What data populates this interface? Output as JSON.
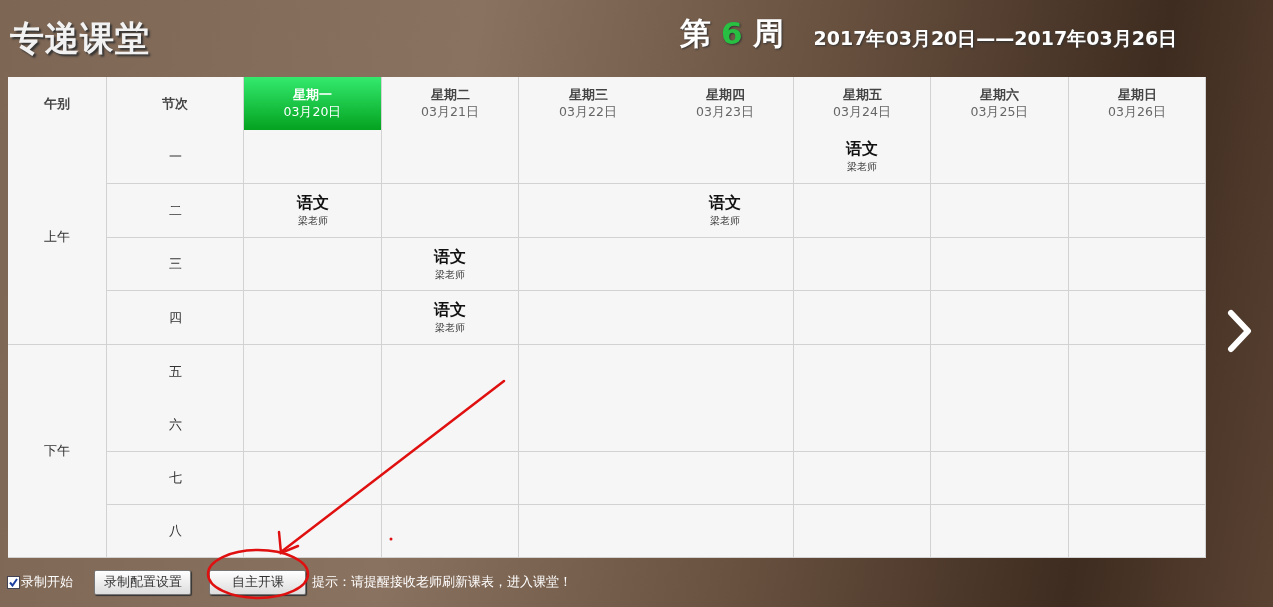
{
  "logo": "专递课堂",
  "week": {
    "prefix": "第",
    "number": "6",
    "suffix": "周"
  },
  "date_range": "2017年03月20日——2017年03月26日",
  "table": {
    "session_heading": "午别",
    "period_heading": "节次",
    "days": [
      {
        "name": "星期一",
        "date": "03月20日",
        "selected": true,
        "line_right": true
      },
      {
        "name": "星期二",
        "date": "03月21日",
        "selected": false,
        "line_right": true
      },
      {
        "name": "星期三",
        "date": "03月22日",
        "selected": false,
        "line_right": false
      },
      {
        "name": "星期四",
        "date": "03月23日",
        "selected": false,
        "line_right": true
      },
      {
        "name": "星期五",
        "date": "03月24日",
        "selected": false,
        "line_right": true
      },
      {
        "name": "星期六",
        "date": "03月25日",
        "selected": false,
        "line_right": true
      },
      {
        "name": "星期日",
        "date": "03月26日",
        "selected": false,
        "line_right": true
      }
    ],
    "sessions": [
      {
        "label": "上午",
        "periods": [
          {
            "label": "一",
            "line_below": true,
            "cells": [
              {},
              {},
              {},
              {},
              {
                "course": "语文",
                "teacher": "梁老师"
              },
              {},
              {}
            ]
          },
          {
            "label": "二",
            "line_below": true,
            "cells": [
              {
                "course": "语文",
                "teacher": "梁老师"
              },
              {},
              {},
              {
                "course": "语文",
                "teacher": "梁老师"
              },
              {},
              {},
              {}
            ]
          },
          {
            "label": "三",
            "line_below": true,
            "cells": [
              {},
              {
                "course": "语文",
                "teacher": "梁老师"
              },
              {},
              {},
              {},
              {},
              {}
            ]
          },
          {
            "label": "四",
            "line_below": true,
            "cells": [
              {},
              {
                "course": "语文",
                "teacher": "梁老师"
              },
              {},
              {},
              {},
              {},
              {}
            ]
          }
        ]
      },
      {
        "label": "下午",
        "periods": [
          {
            "label": "五",
            "line_below": false,
            "cells": [
              {},
              {},
              {},
              {},
              {},
              {},
              {}
            ]
          },
          {
            "label": "六",
            "line_below": true,
            "cells": [
              {},
              {},
              {},
              {},
              {},
              {},
              {}
            ]
          },
          {
            "label": "七",
            "line_below": true,
            "cells": [
              {},
              {},
              {},
              {},
              {},
              {},
              {}
            ]
          },
          {
            "label": "八",
            "line_below": true,
            "cells": [
              {},
              {},
              {},
              {},
              {},
              {},
              {}
            ]
          }
        ]
      }
    ]
  },
  "bottom_bar": {
    "record_checkbox": {
      "label": "录制开始",
      "checked": true
    },
    "buttons": [
      "录制配置设置",
      "自主开课"
    ],
    "hint": "提示：请提醒接收老师刷新课表，进入课堂！"
  }
}
